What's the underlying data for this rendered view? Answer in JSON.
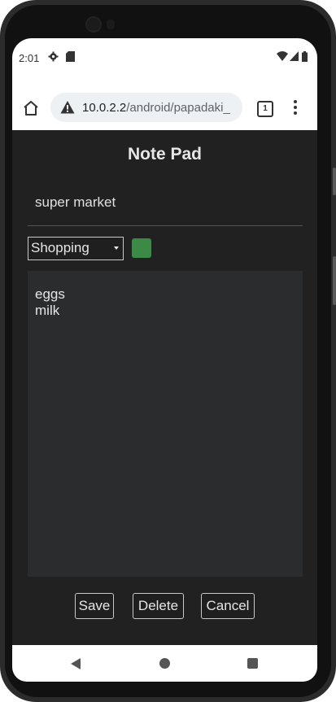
{
  "status_bar": {
    "time": "2:01",
    "icons": [
      "settings-icon",
      "sd-card-icon",
      "wifi-icon",
      "signal-icon",
      "battery-icon"
    ]
  },
  "browser": {
    "url_host": "10.0.2.2",
    "url_path": "/android/papadaki_",
    "tab_count": "1",
    "icons": [
      "home-icon",
      "not-secure-warning-icon",
      "more-vert-icon"
    ]
  },
  "app": {
    "title": "Note Pad",
    "note_title_value": "super market",
    "category": {
      "selected": "Shopping"
    },
    "color": "#3b8a45",
    "note_lines": [
      "eggs",
      "milk"
    ],
    "buttons": {
      "save": "Save",
      "delete": "Delete",
      "cancel": "Cancel"
    }
  },
  "nav_bar": {
    "icons": [
      "back-icon",
      "home-circle-icon",
      "recents-icon"
    ]
  }
}
